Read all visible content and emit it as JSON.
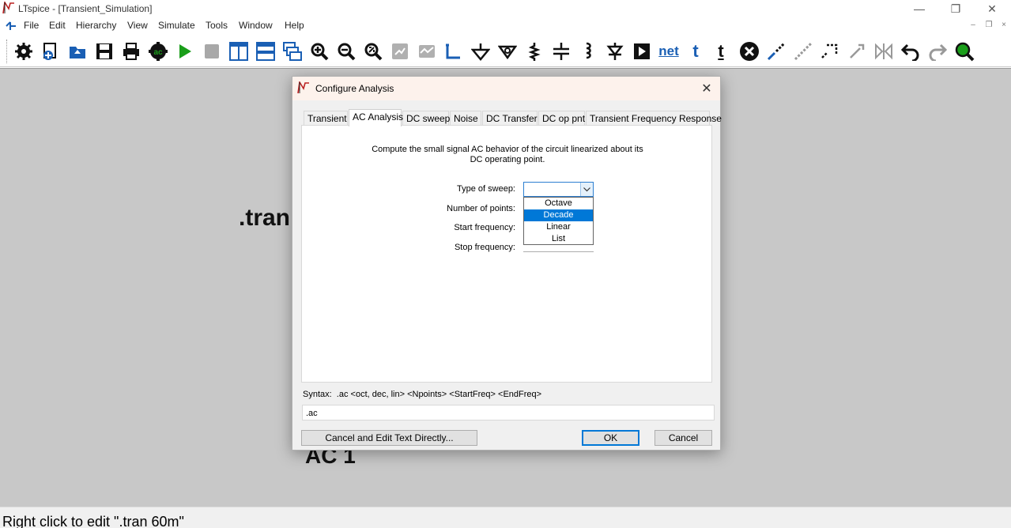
{
  "app": {
    "title": "LTspice - [Transient_Simulation]"
  },
  "window_controls": {
    "minimize": "—",
    "restore": "❐",
    "close": "✕",
    "mdi_minimize": "–",
    "mdi_restore": "❐",
    "mdi_close": "×"
  },
  "menu": {
    "items": [
      "File",
      "Edit",
      "Hierarchy",
      "View",
      "Simulate",
      "Tools",
      "Window",
      "Help"
    ]
  },
  "toolbar": {
    "net_label": "net",
    "t_label": "t",
    "t2_label": "t"
  },
  "schematic": {
    "tran_directive": ".tran",
    "ac_directive": "AC 1"
  },
  "status_bar": {
    "text": "Right click to edit \".tran 60m\""
  },
  "dialog": {
    "title": "Configure Analysis",
    "close_symbol": "✕",
    "tabs": [
      "Transient",
      "AC Analysis",
      "DC sweep",
      "Noise",
      "DC Transfer",
      "DC op pnt",
      "Transient Frequency Response"
    ],
    "active_tab": "AC Analysis",
    "description": "Compute the small signal AC behavior of the circuit linearized about its DC operating point.",
    "fields": {
      "type_of_sweep": "Type of sweep:",
      "number_of_points": "Number of points:",
      "start_frequency": "Start frequency:",
      "stop_frequency": "Stop frequency:"
    },
    "sweep_value": "",
    "sweep_options": [
      "Octave",
      "Decade",
      "Linear",
      "List"
    ],
    "sweep_highlighted": "Decade",
    "syntax": "Syntax:  .ac <oct, dec, lin> <Npoints> <StartFreq> <EndFreq>",
    "command": ".ac",
    "buttons": {
      "edit_text": "Cancel and Edit Text Directly...",
      "ok": "OK",
      "cancel": "Cancel"
    }
  },
  "colors": {
    "accent": "#0078d7",
    "workspace": "#c8c8c8",
    "toolbar_icon_dark": "#111111",
    "toolbar_icon_blue": "#1a5fb4",
    "run_green": "#1a9e1a"
  }
}
